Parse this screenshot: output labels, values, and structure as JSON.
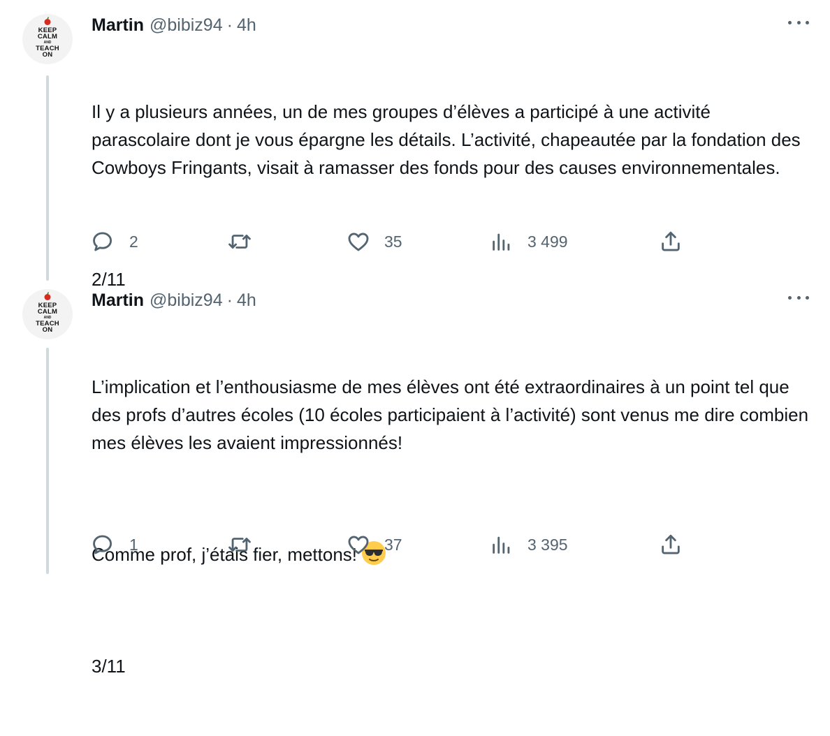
{
  "tweets": [
    {
      "avatar": {
        "line1": "KEEP",
        "line2": "CALM",
        "line3": "AND",
        "line4": "TEACH",
        "line5": "ON"
      },
      "name": "Martin",
      "handle": "@bibiz94",
      "separator": "·",
      "time": "4h",
      "paragraphs": [
        "Il y a plusieurs années, un de mes groupes d’élèves a participé à une activité parascolaire dont je vous épargne les détails. L’activité, chapeautée par la fondation des Cowboys Fringants, visait à ramasser des fonds pour des causes environnementales.",
        "2/11"
      ],
      "replies": "2",
      "retweets": "",
      "likes": "35",
      "views": "3 499"
    },
    {
      "avatar": {
        "line1": "KEEP",
        "line2": "CALM",
        "line3": "AND",
        "line4": "TEACH",
        "line5": "ON"
      },
      "name": "Martin",
      "handle": "@bibiz94",
      "separator": "·",
      "time": "4h",
      "paragraphs": [
        "L’implication et l’enthousiasme de mes élèves ont été extraordinaires à un point tel que des profs d’autres écoles (10 écoles participaient à l’activité) sont venus me dire combien mes élèves les avaient impressionnés!",
        "Comme prof, j’étais fier, mettons!",
        "3/11"
      ],
      "emoji": "smiling-face-with-sunglasses",
      "replies": "1",
      "retweets": "",
      "likes": "37",
      "views": "3 395"
    }
  ],
  "icons": {
    "reply": "speech-bubble-icon",
    "retweet": "retweet-icon",
    "like": "heart-icon",
    "views": "bar-chart-icon",
    "share": "share-upload-icon",
    "more": "more-dots-icon"
  },
  "colors": {
    "text": "#0f1419",
    "secondary": "#536471",
    "thread_line": "#cfd9de",
    "apple": "#d62b20",
    "emoji_face": "#ffcc4d"
  }
}
